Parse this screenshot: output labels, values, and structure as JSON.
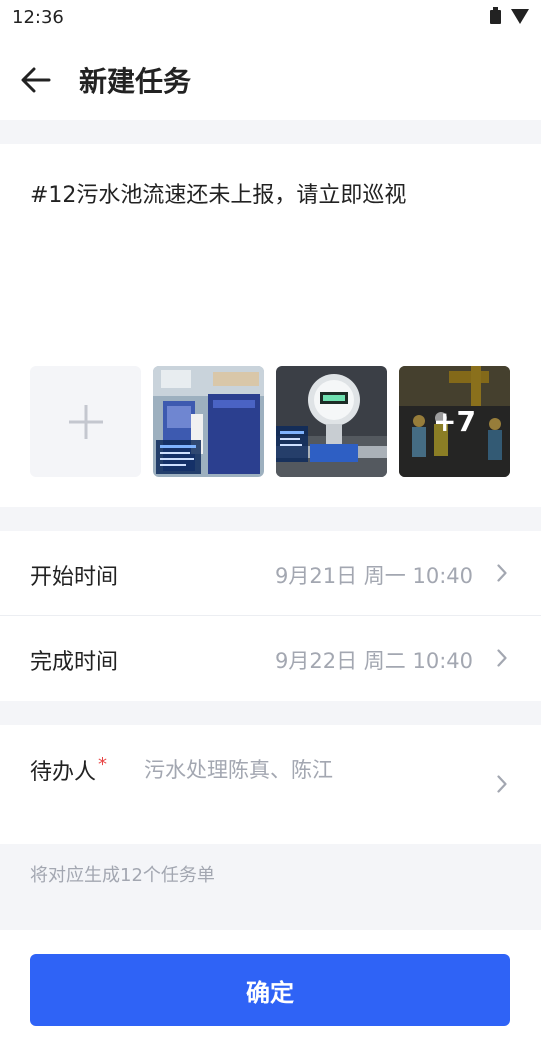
{
  "status_bar": {
    "time": "12:36"
  },
  "header": {
    "title": "新建任务"
  },
  "task": {
    "description": "#12污水池流速还未上报，请立即巡视",
    "more_images_count": "+7"
  },
  "schedule": {
    "start_label": "开始时间",
    "start_value": "9月21日  周一 10:40",
    "end_label": "完成时间",
    "end_value": "9月22日  周二  10:40"
  },
  "assignee": {
    "label": "待办人",
    "required_mark": "*",
    "value": "污水处理陈真、陈江"
  },
  "hint": "将对应生成12个任务单",
  "footer": {
    "confirm_label": "确定"
  },
  "colors": {
    "primary": "#2f63f6",
    "required": "#e84545",
    "muted": "#a3a7b1"
  },
  "icons": {
    "back": "arrow-left-icon",
    "chevron": "chevron-right-icon",
    "add": "plus-icon",
    "battery": "battery-icon",
    "signal": "signal-icon"
  }
}
